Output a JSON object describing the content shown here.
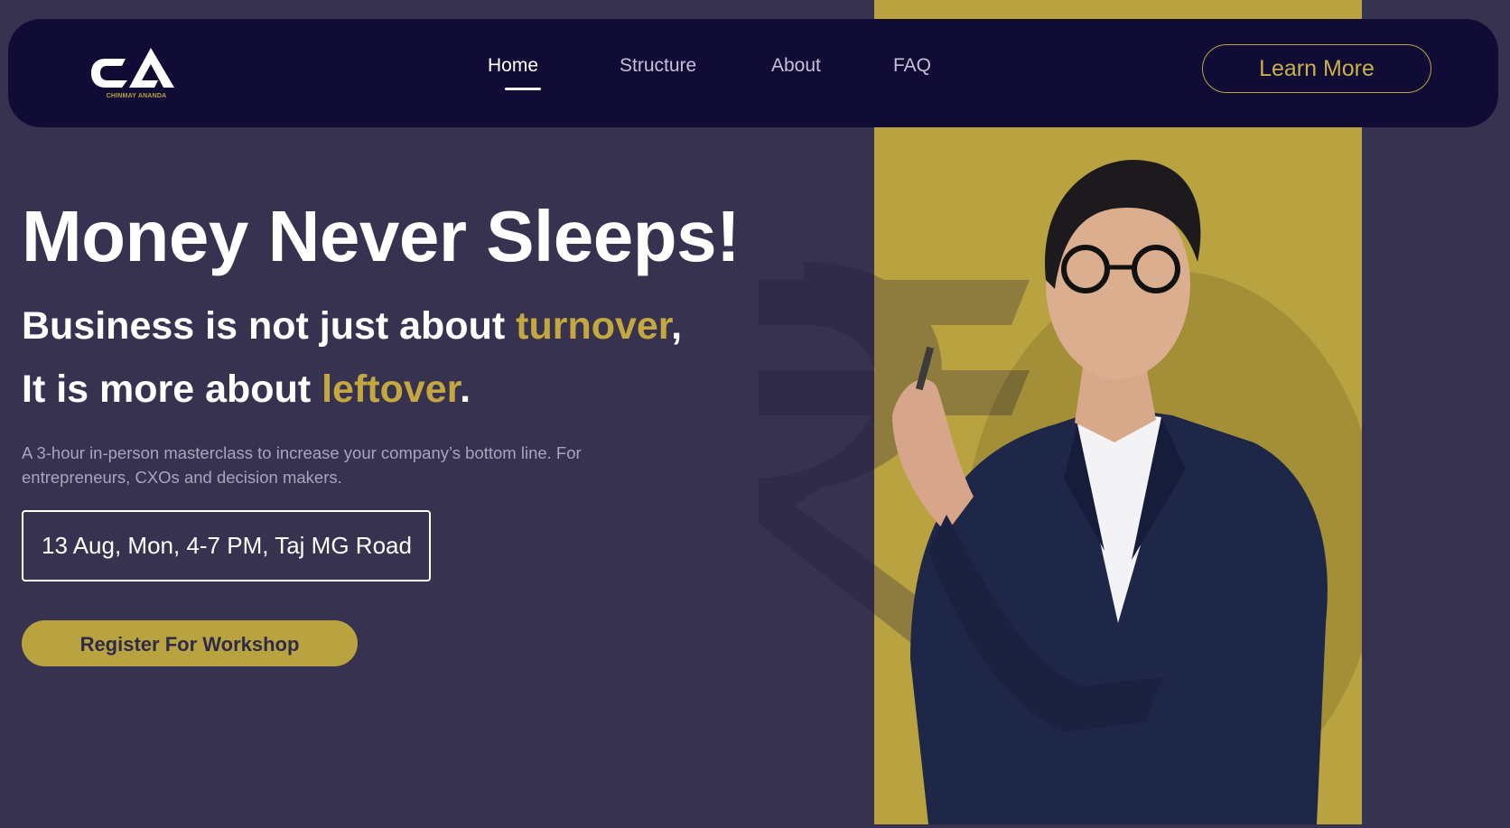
{
  "brand": {
    "logo_text": "CA",
    "logo_caption": "CHINMAY ANANDA"
  },
  "nav": {
    "links": [
      {
        "label": "Home",
        "active": true
      },
      {
        "label": "Structure",
        "active": false
      },
      {
        "label": "About",
        "active": false
      },
      {
        "label": "FAQ",
        "active": false
      }
    ],
    "cta_label": "Learn More"
  },
  "hero": {
    "title": "Money Never Sleeps!",
    "line1_prefix": "Business is not just about ",
    "line1_accent": "turnover",
    "line1_suffix": ",",
    "line2_prefix": "It is more about ",
    "line2_accent": "leftover",
    "line2_suffix": ".",
    "description": "A 3-hour in-person masterclass to increase your company’s bottom line. For entrepreneurs, CXOs and decision makers.",
    "event_details": "13 Aug, Mon, 4-7 PM, Taj MG Road",
    "register_label": "Register For Workshop"
  },
  "colors": {
    "background": "#363250",
    "navbar": "#100c35",
    "accent_gold": "#b9a340",
    "text": "#ffffff"
  },
  "icons": [
    "rupee-watermark-icon",
    "presenter-portrait"
  ]
}
